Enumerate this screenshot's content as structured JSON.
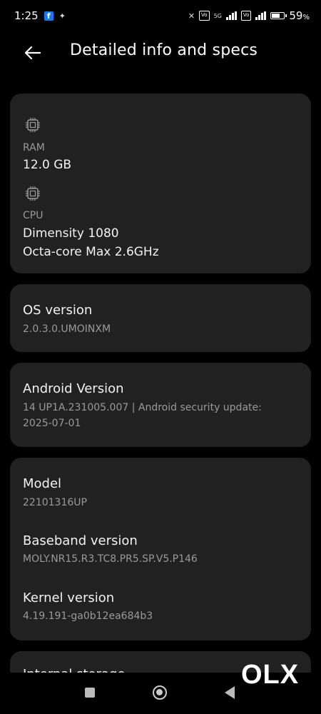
{
  "status_bar": {
    "time": "1:25",
    "battery_percent": "59",
    "battery_level": 0.59,
    "network_label": "5G"
  },
  "header": {
    "title": "Detailed info and specs",
    "back_icon": "arrow-left-icon"
  },
  "hardware": {
    "ram_label": "RAM",
    "ram_value": "12.0 GB",
    "cpu_label": "CPU",
    "cpu_name": "Dimensity 1080",
    "cpu_detail": "Octa-core Max 2.6GHz"
  },
  "os": {
    "label": "OS version",
    "value": "2.0.3.0.UMOINXM"
  },
  "android": {
    "label": "Android Version",
    "value_line1": "14 UP1A.231005.007 | Android security update:",
    "value_line2": "2025-07-01"
  },
  "device": {
    "model_label": "Model",
    "model_value": "22101316UP",
    "baseband_label": "Baseband version",
    "baseband_value": "MOLY.NR15.R3.TC8.PR5.SP.V5.P146",
    "kernel_label": "Kernel version",
    "kernel_value": "4.19.191-ga0b12ea684b3"
  },
  "partial_card": {
    "label": "Internal storage"
  },
  "watermark": {
    "text": "OLX"
  },
  "colors": {
    "background": "#000000",
    "card": "#212121",
    "secondary_text": "#9a9a9a"
  }
}
